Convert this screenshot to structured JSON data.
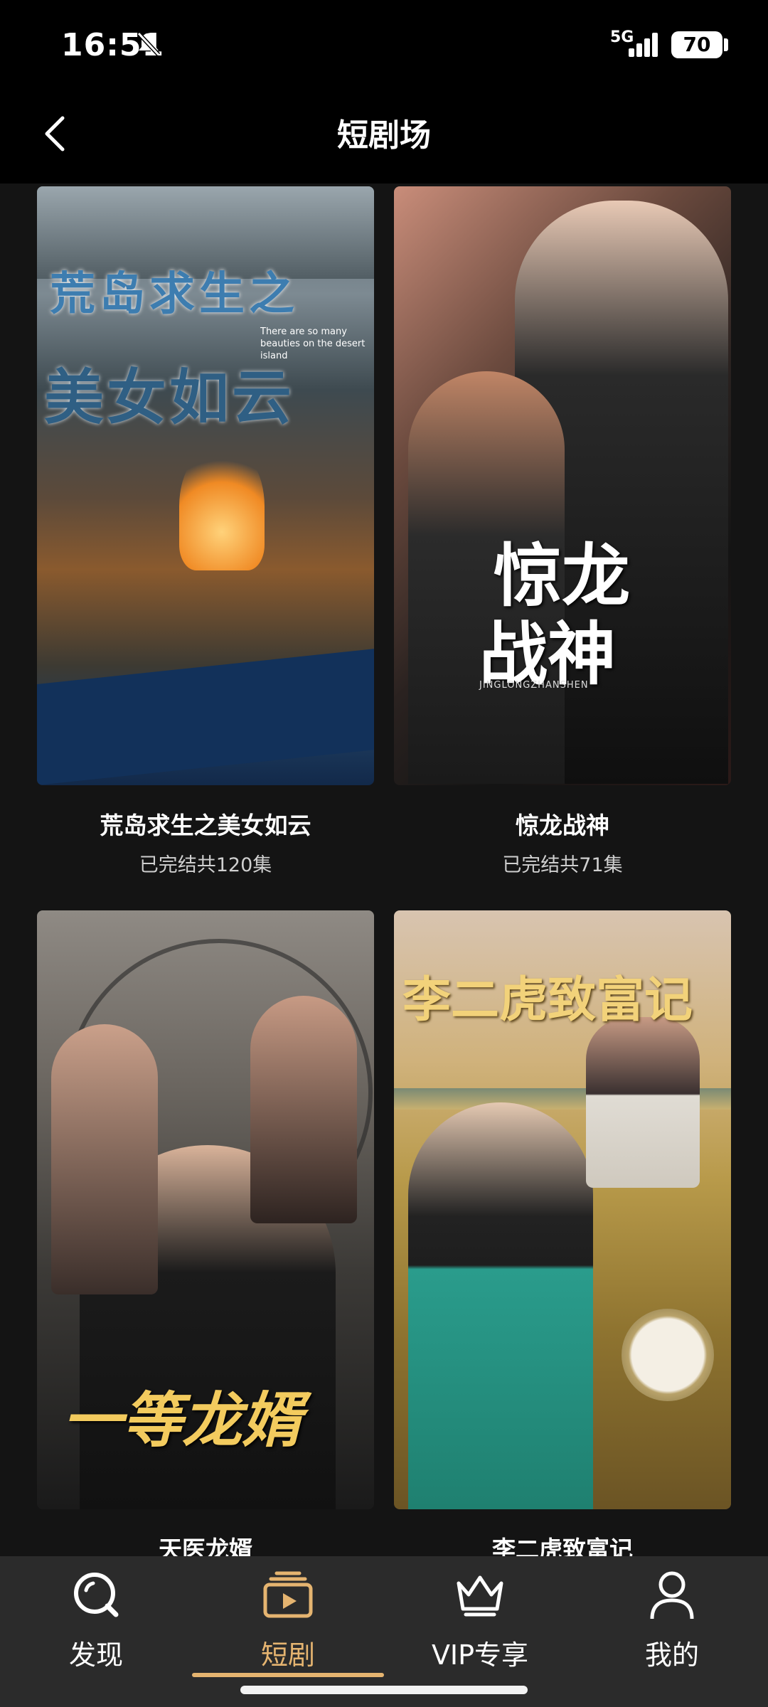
{
  "status_bar": {
    "time": "16:51",
    "network": "5G",
    "battery": "70"
  },
  "header": {
    "title": "短剧场"
  },
  "dramas": [
    {
      "title": "荒岛求生之美女如云",
      "status": "已完结共120集",
      "poster_text": {
        "line1": "荒岛求生之",
        "line2": "美女如云",
        "english": "There are so many beauties on the desert island"
      }
    },
    {
      "title": "惊龙战神",
      "status": "已完结共71集",
      "poster_text": {
        "line1": "惊龙",
        "line2": "战神",
        "english": "JINGLONGZHANSHEN"
      }
    },
    {
      "title": "天医龙婿",
      "status": "",
      "poster_text": {
        "line1": "一等龙婿"
      }
    },
    {
      "title": "李二虎致富记",
      "status": "",
      "poster_text": {
        "line1": "李二虎致富记"
      }
    }
  ],
  "bottom_nav": [
    {
      "label": "发现",
      "icon": "discover-icon",
      "active": false
    },
    {
      "label": "短剧",
      "icon": "short-drama-icon",
      "active": true
    },
    {
      "label": "VIP专享",
      "icon": "crown-icon",
      "active": false
    },
    {
      "label": "我的",
      "icon": "profile-icon",
      "active": false
    }
  ],
  "colors": {
    "accent": "#e5b470",
    "background": "#141414",
    "nav_background": "#2b2b2b"
  }
}
